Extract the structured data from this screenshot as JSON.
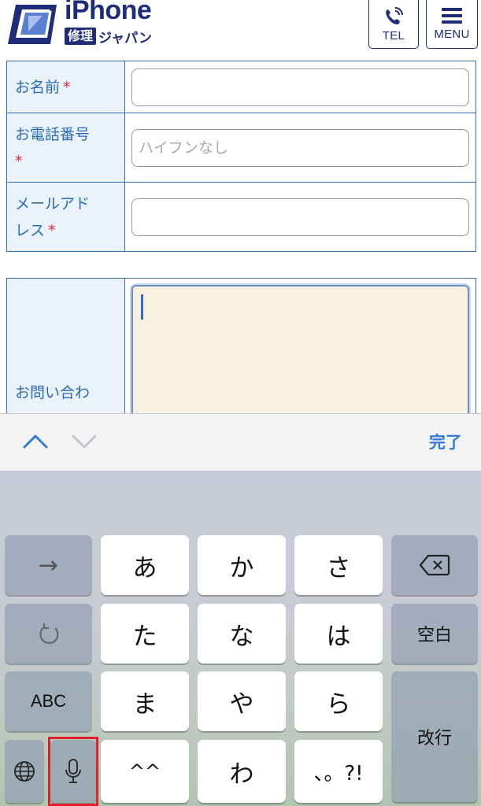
{
  "header": {
    "logo_main": "iPhone",
    "logo_badge": "修理",
    "logo_kana": "ジャパン",
    "tel_label": "TEL",
    "menu_label": "MENU"
  },
  "form": {
    "required_mark": "*",
    "name_label": "お名前",
    "phone_label": "お電話番号",
    "phone_placeholder": "ハイフンなし",
    "email_label_1": "メールアド",
    "email_label_2": "レス",
    "inquiry_label": "お問い合わ"
  },
  "toolbar": {
    "done_label": "完了"
  },
  "keyboard": {
    "row1": [
      "→",
      "あ",
      "か",
      "さ",
      "⌫"
    ],
    "row2": [
      "↺",
      "た",
      "な",
      "は",
      "空白"
    ],
    "row3": [
      "ABC",
      "ま",
      "や",
      "ら"
    ],
    "row4": [
      "🌐",
      "🎤",
      "^^",
      "わ",
      "、。?!"
    ],
    "return_label": "改行"
  },
  "colors": {
    "brand": "#1e2c7a",
    "label_text": "#2a6cb7",
    "required": "#e0253a",
    "done": "#2f7bd6",
    "highlight": "#e0202a"
  }
}
